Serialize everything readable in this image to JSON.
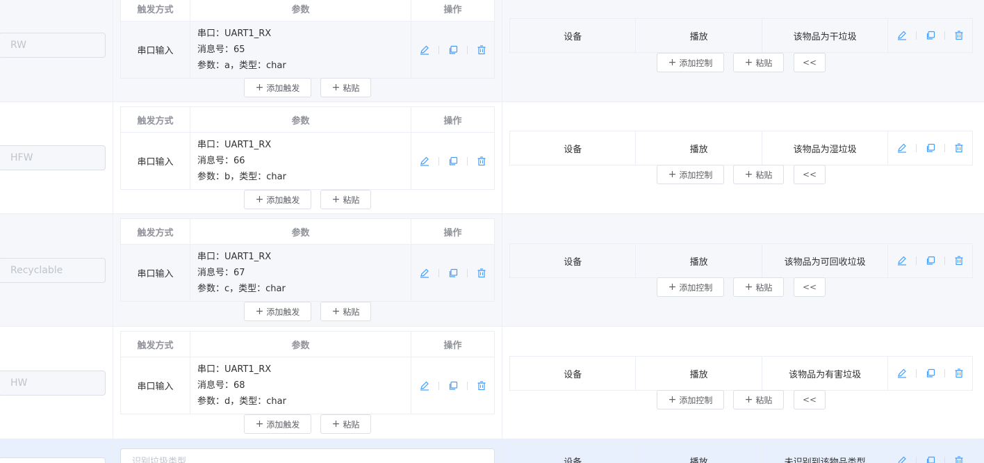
{
  "headers": {
    "trigger_type": "触发方式",
    "params": "参数",
    "ops": "操作"
  },
  "control_headers": {
    "device": "设备",
    "play": "播放"
  },
  "buttons": {
    "add_trigger": "添加触发",
    "paste": "粘贴",
    "add_control": "添加控制",
    "collapse": "<<"
  },
  "icons": {
    "edit": "edit-icon",
    "copy": "copy-icon",
    "delete": "delete-icon",
    "plus": "plus-icon"
  },
  "accent_color": "#409eff",
  "rows": [
    {
      "name": "RW",
      "trigger_type": "串口输入",
      "param_port": "串口：UART1_RX",
      "param_msg": "消息号：65",
      "param_arg": "参数：a，类型：char",
      "control_text": "该物品为干垃圾"
    },
    {
      "name": "HFW",
      "trigger_type": "串口输入",
      "param_port": "串口：UART1_RX",
      "param_msg": "消息号：66",
      "param_arg": "参数：b，类型：char",
      "control_text": "该物品为湿垃圾"
    },
    {
      "name": "Recyclable",
      "trigger_type": "串口输入",
      "param_port": "串口：UART1_RX",
      "param_msg": "消息号：67",
      "param_arg": "参数：c，类型：char",
      "control_text": "该物品为可回收垃圾"
    },
    {
      "name": "HW",
      "trigger_type": "串口输入",
      "param_port": "串口：UART1_RX",
      "param_msg": "消息号：68",
      "param_arg": "参数：d，类型：char",
      "control_text": "该物品为有害垃圾"
    }
  ],
  "last_row": {
    "trigger_placeholder": "识别垃圾类型",
    "control_text": "未识别到该物品类型"
  }
}
